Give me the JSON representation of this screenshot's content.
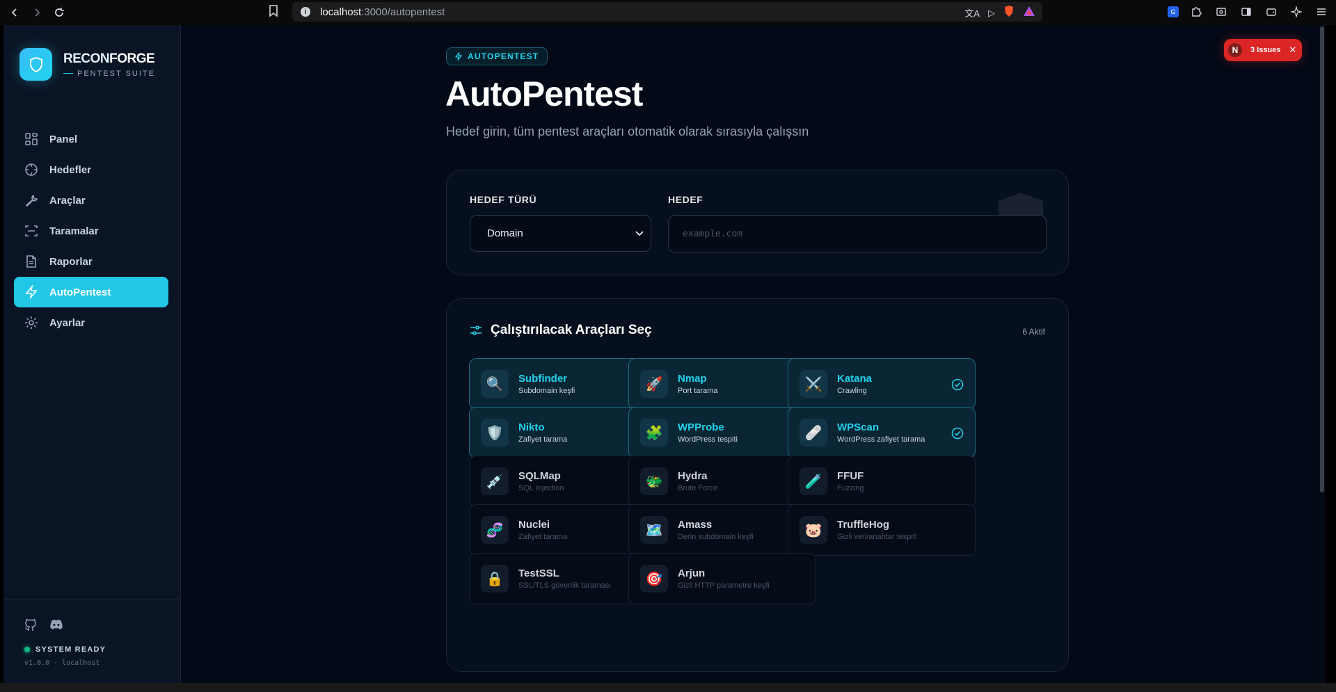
{
  "browser": {
    "url_host": "localhost",
    "url_path": ":3000/autopentest"
  },
  "brand": {
    "name_a": "RECON",
    "name_b": "FORGE",
    "tagline": "PENTEST SUITE"
  },
  "sidebar": {
    "items": [
      {
        "label": "Panel",
        "icon": "grid-icon"
      },
      {
        "label": "Hedefler",
        "icon": "crosshair-icon"
      },
      {
        "label": "Araçlar",
        "icon": "wrench-icon"
      },
      {
        "label": "Taramalar",
        "icon": "scan-icon"
      },
      {
        "label": "Raporlar",
        "icon": "document-icon"
      },
      {
        "label": "AutoPentest",
        "icon": "bolt-icon",
        "active": true
      },
      {
        "label": "Ayarlar",
        "icon": "gear-icon"
      }
    ],
    "status": "SYSTEM READY",
    "version": "v1.0.0 · localhost"
  },
  "header": {
    "badge": "AUTOPENTEST",
    "title": "AutoPentest",
    "subtitle": "Hedef girin, tüm pentest araçları otomatik olarak sırasıyla çalışsın"
  },
  "form": {
    "target_type_label": "HEDEF TÜRÜ",
    "target_type_value": "Domain",
    "target_label": "HEDEF",
    "target_placeholder": "example.com"
  },
  "tools": {
    "heading": "Çalıştırılacak Araçları Seç",
    "active_count": "6 Aktif",
    "items": [
      {
        "name": "Subfinder",
        "desc": "Subdomain keşfi",
        "emoji": "🔍",
        "selected": true
      },
      {
        "name": "Nmap",
        "desc": "Port tarama",
        "emoji": "🚀",
        "selected": true
      },
      {
        "name": "Katana",
        "desc": "Crawling",
        "emoji": "⚔️",
        "selected": true
      },
      {
        "name": "Nikto",
        "desc": "Zafiyet tarama",
        "emoji": "🛡️",
        "selected": true
      },
      {
        "name": "WPProbe",
        "desc": "WordPress tespiti",
        "emoji": "🧩",
        "selected": true
      },
      {
        "name": "WPScan",
        "desc": "WordPress zafiyet tarama",
        "emoji": "🩹",
        "selected": true
      },
      {
        "name": "SQLMap",
        "desc": "SQL Injection",
        "emoji": "💉",
        "selected": false
      },
      {
        "name": "Hydra",
        "desc": "Brute Force",
        "emoji": "🐲",
        "selected": false
      },
      {
        "name": "FFUF",
        "desc": "Fuzzing",
        "emoji": "🧪",
        "selected": false
      },
      {
        "name": "Nuclei",
        "desc": "Zafiyet tarama",
        "emoji": "🧬",
        "selected": false
      },
      {
        "name": "Amass",
        "desc": "Derin subdomain keşfi",
        "emoji": "🗺️",
        "selected": false
      },
      {
        "name": "TruffleHog",
        "desc": "Gizli veri/anahtar tespiti",
        "emoji": "🐷",
        "selected": false
      },
      {
        "name": "TestSSL",
        "desc": "SSL/TLS güvenlik taraması",
        "emoji": "🔒",
        "selected": false
      },
      {
        "name": "Arjun",
        "desc": "Gizli HTTP parametre keşfi",
        "emoji": "🎯",
        "selected": false
      }
    ]
  },
  "issues": {
    "avatar": "N",
    "label": "3 Issues"
  },
  "colors": {
    "accent": "#22d3ee",
    "background": "#030916",
    "error": "#dc2626",
    "ready": "#10b981"
  }
}
